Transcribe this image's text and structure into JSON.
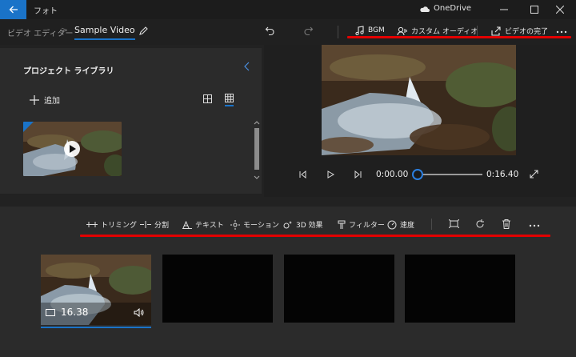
{
  "window": {
    "app_title": "フォト",
    "cloud_label": "OneDrive"
  },
  "nav": {
    "breadcrumb_parent": "ビデオ エディター",
    "breadcrumb_separator": ">",
    "project_name": "Sample Video",
    "bgm_label": "BGM",
    "custom_audio_label": "カスタム オーディオ",
    "finish_label": "ビデオの完了"
  },
  "library": {
    "title": "プロジェクト ライブラリ",
    "add_label": "追加"
  },
  "player": {
    "current_time": "0:00.00",
    "total_time": "0:16.40",
    "progress": 0
  },
  "storyboard": {
    "tools": [
      {
        "id": "trim",
        "label": "トリミング",
        "icon": "trim-icon"
      },
      {
        "id": "split",
        "label": "分割",
        "icon": "split-icon"
      },
      {
        "id": "text",
        "label": "テキスト",
        "icon": "text-icon"
      },
      {
        "id": "motion",
        "label": "モーション",
        "icon": "motion-icon"
      },
      {
        "id": "effects3d",
        "label": "3D 効果",
        "icon": "3d-effects-icon"
      },
      {
        "id": "filter",
        "label": "フィルター",
        "icon": "filter-icon"
      },
      {
        "id": "speed",
        "label": "速度",
        "icon": "speed-icon"
      }
    ],
    "clip_duration": "16.38"
  },
  "colors": {
    "accent": "#1a73c8",
    "highlight_underline": "#e30000"
  }
}
